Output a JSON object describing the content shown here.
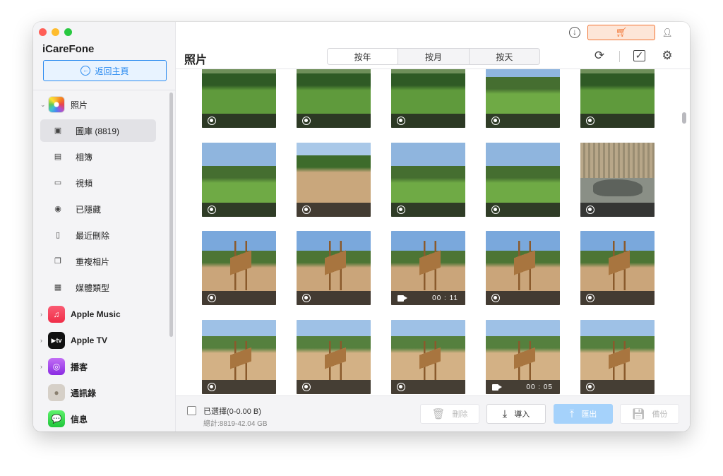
{
  "app": {
    "title": "iCareFone",
    "home_button": "返回主頁"
  },
  "sidebar": {
    "photos_label": "照片",
    "sub_items": [
      {
        "label": "圖庫 (8819)",
        "icon": "gallery-icon"
      },
      {
        "label": "相簿",
        "icon": "album-icon"
      },
      {
        "label": "視頻",
        "icon": "video-icon"
      },
      {
        "label": "已隱藏",
        "icon": "eye-icon"
      },
      {
        "label": "最近刪除",
        "icon": "trash-icon"
      },
      {
        "label": "重複相片",
        "icon": "duplicate-icon"
      },
      {
        "label": "媒體類型",
        "icon": "media-type-icon"
      }
    ],
    "apps": [
      {
        "label": "Apple Music"
      },
      {
        "label": "Apple TV"
      },
      {
        "label": "播客"
      },
      {
        "label": "通訊錄"
      },
      {
        "label": "信息"
      }
    ]
  },
  "header": {
    "title": "照片",
    "tabs": [
      "按年",
      "按月",
      "按天"
    ],
    "selected_tab": "按年"
  },
  "grid": {
    "videos": [
      {
        "row": 2,
        "col": 2,
        "duration": "00 : 11"
      },
      {
        "row": 3,
        "col": 3,
        "duration": "00 : 05"
      }
    ]
  },
  "footer": {
    "selected": "已選擇(0-0.00 B)",
    "total": "總計:8819-42.04 GB",
    "delete": "刪除",
    "import": "導入",
    "export": "匯出",
    "backup": "備份"
  },
  "colors": {
    "accent": "#2d8cf0",
    "cart": "#f2722f",
    "export_bg": "#a5d2fb"
  }
}
